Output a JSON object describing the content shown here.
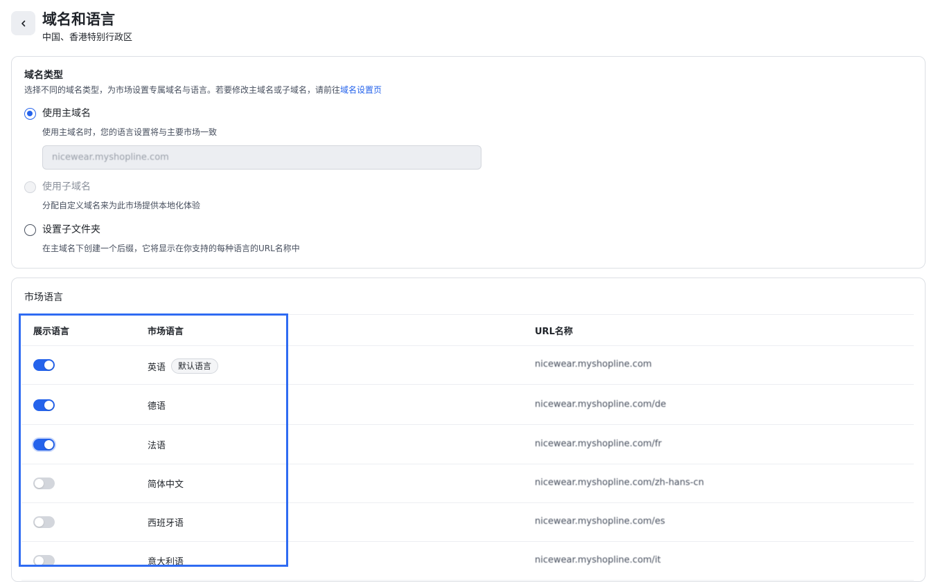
{
  "header": {
    "title": "域名和语言",
    "subtitle": "中国、香港特别行政区"
  },
  "domain_section": {
    "title": "域名类型",
    "description": "选择不同的域名类型，为市场设置专属域名与语言。若要修改主域名或子域名，请前往",
    "description_link": "域名设置页",
    "options": [
      {
        "label": "使用主域名",
        "desc": "使用主域名时，您的语言设置将与主要市场一致",
        "state": "checked"
      },
      {
        "label": "使用子域名",
        "desc": "分配自定义域名来为此市场提供本地化体验",
        "state": "disabled"
      },
      {
        "label": "设置子文件夹",
        "desc": "在主域名下创建一个后缀，它将显示在你支持的每种语言的URL名称中",
        "state": "unchecked"
      }
    ],
    "primary_domain_value": "nicewear.myshopline.com"
  },
  "lang_section": {
    "title": "市场语言",
    "columns": {
      "display": "展示语言",
      "market": "市场语言",
      "url": "URL名称"
    },
    "rows": [
      {
        "enabled": true,
        "language": "英语",
        "badge": "默认语言",
        "url": "nicewear.myshopline.com"
      },
      {
        "enabled": true,
        "language": "德语",
        "badge": "",
        "url": "nicewear.myshopline.com/de"
      },
      {
        "enabled": true,
        "language": "法语",
        "badge": "",
        "url": "nicewear.myshopline.com/fr"
      },
      {
        "enabled": false,
        "language": "简体中文",
        "badge": "",
        "url": "nicewear.myshopline.com/zh-hans-cn"
      },
      {
        "enabled": false,
        "language": "西班牙语",
        "badge": "",
        "url": "nicewear.myshopline.com/es"
      },
      {
        "enabled": false,
        "language": "意大利语",
        "badge": "",
        "url": "nicewear.myshopline.com/it"
      }
    ]
  },
  "colors": {
    "accent": "#2563eb",
    "highlight_box": "#2f6bf2"
  }
}
